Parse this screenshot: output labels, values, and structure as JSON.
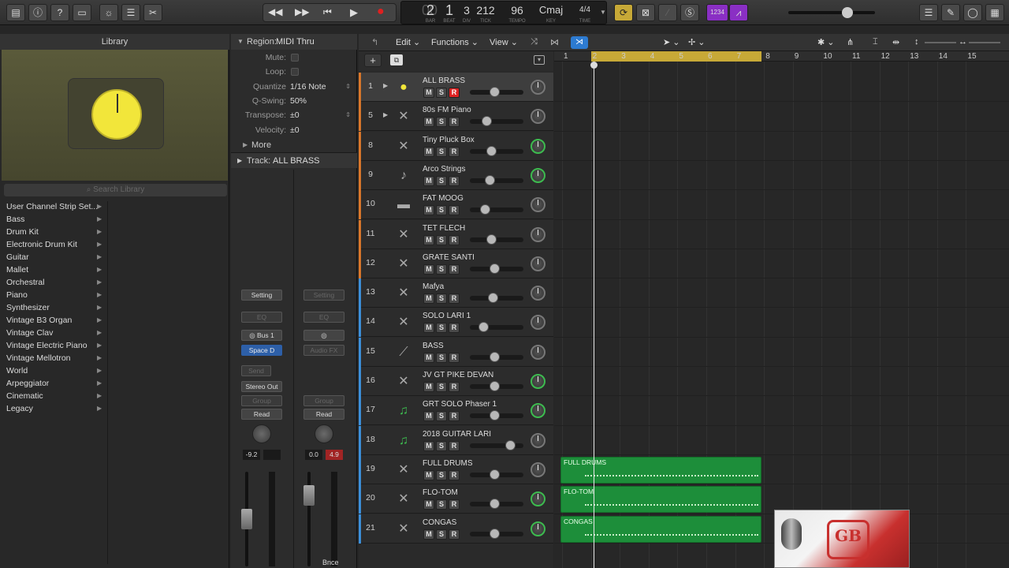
{
  "toolbar": {
    "transport": {
      "rewind": "◀◀",
      "forward": "▶▶",
      "to_start": "⏮",
      "play": "▶",
      "record": "●"
    },
    "lcd": {
      "bar": "2",
      "beat": "1",
      "div": "3",
      "tick": "212",
      "tempo": "96",
      "key": "Cmaj",
      "time": "4/4",
      "bar_label": "BAR",
      "beat_label": "BEAT",
      "div_label": "DIV",
      "tick_label": "TICK",
      "tempo_label": "TEMPO",
      "key_label": "KEY",
      "time_label": "TIME"
    },
    "count_in": "1234"
  },
  "library": {
    "title": "Library",
    "search_placeholder": "Search Library",
    "items": [
      "User Channel Strip Set...",
      "Bass",
      "Drum Kit",
      "Electronic Drum Kit",
      "Guitar",
      "Mallet",
      "Orchestral",
      "Piano",
      "Synthesizer",
      "Vintage B3 Organ",
      "Vintage Clav",
      "Vintage Electric Piano",
      "Vintage Mellotron",
      "World",
      "Arpeggiator",
      "Cinematic",
      "Legacy"
    ]
  },
  "inspector": {
    "region_label": "Region:",
    "region_name": "MIDI Thru",
    "rows": [
      {
        "label": "Mute:",
        "value": ""
      },
      {
        "label": "Loop:",
        "value": ""
      },
      {
        "label": "Quantize",
        "value": "1/16 Note"
      },
      {
        "label": "Q-Swing:",
        "value": "50%"
      },
      {
        "label": "Transpose:",
        "value": "±0"
      },
      {
        "label": "Velocity:",
        "value": "±0"
      }
    ],
    "more": "More",
    "track_label": "Track:",
    "track_name": "ALL BRASS",
    "strip1": {
      "setting": "Setting",
      "eq": "EQ",
      "bus": "Bus 1",
      "insert": "Space D",
      "send": "Send",
      "output": "Stereo Out",
      "group": "Group",
      "auto": "Read",
      "vol": "-9.2"
    },
    "strip2": {
      "setting": "Setting",
      "eq": "EQ",
      "insert": "Audio FX",
      "group": "Group",
      "auto": "Read",
      "vol": "0.0",
      "peak": "4.9",
      "name": "Bnce"
    }
  },
  "tracks_bar": {
    "menus": [
      "Edit",
      "Functions",
      "View"
    ]
  },
  "tracks": [
    {
      "num": "1",
      "name": "ALL BRASS",
      "record": true,
      "icon": "yellow-knob-icon",
      "pan": "gray",
      "sel": true,
      "color": "#d9772b",
      "fader": 0.45
    },
    {
      "num": "5",
      "name": "80s FM Piano",
      "record": false,
      "icon": "keyboard-icon",
      "pan": "gray",
      "color": "#d9772b",
      "fader": 0.27
    },
    {
      "num": "8",
      "name": "Tiny Pluck Box",
      "record": false,
      "icon": "keyboard-icon",
      "pan": "green",
      "color": "#d9772b",
      "fader": 0.39
    },
    {
      "num": "9",
      "name": "Arco Strings",
      "record": false,
      "icon": "violin-icon",
      "pan": "green",
      "color": "#d9772b",
      "fader": 0.35
    },
    {
      "num": "10",
      "name": "FAT MOOG",
      "record": false,
      "icon": "synth-icon",
      "pan": "gray",
      "color": "#d9772b",
      "fader": 0.24
    },
    {
      "num": "11",
      "name": "TET FLECH",
      "record": false,
      "icon": "keyboard-icon",
      "pan": "gray",
      "color": "#d9772b",
      "fader": 0.39
    },
    {
      "num": "12",
      "name": "GRATE SANTI",
      "record": false,
      "icon": "keyboard-icon",
      "pan": "gray",
      "color": "#d9772b",
      "fader": 0.45
    },
    {
      "num": "13",
      "name": "Mafya",
      "record": false,
      "icon": "keyboard-icon",
      "pan": "gray",
      "color": "#3c8fd9",
      "fader": 0.41
    },
    {
      "num": "14",
      "name": "SOLO LARI 1",
      "record": false,
      "icon": "keyboard-icon",
      "pan": "gray",
      "color": "#3c8fd9",
      "fader": 0.2
    },
    {
      "num": "15",
      "name": "BASS",
      "record": false,
      "icon": "guitar-icon",
      "pan": "gray",
      "color": "#3c8fd9",
      "fader": 0.45
    },
    {
      "num": "16",
      "name": "JV GT PIKE DEVAN",
      "record": false,
      "icon": "keyboard-icon",
      "pan": "green",
      "color": "#3c8fd9",
      "fader": 0.45
    },
    {
      "num": "17",
      "name": "GRT SOLO Phaser 1",
      "record": false,
      "icon": "music-note-icon",
      "pan": "green",
      "color": "#3c8fd9",
      "fader": 0.45
    },
    {
      "num": "18",
      "name": "2018 GUITAR LARI",
      "record": false,
      "icon": "music-note-icon",
      "pan": "gray",
      "color": "#3c8fd9",
      "fader": 0.82
    },
    {
      "num": "19",
      "name": "FULL DRUMS",
      "record": false,
      "icon": "keyboard-icon",
      "pan": "gray",
      "color": "#3c8fd9",
      "fader": 0.45
    },
    {
      "num": "20",
      "name": "FLO-TOM",
      "record": false,
      "icon": "keyboard-icon",
      "pan": "green",
      "color": "#3c8fd9",
      "fader": 0.45
    },
    {
      "num": "21",
      "name": "CONGAS",
      "record": false,
      "icon": "keyboard-icon",
      "pan": "green",
      "color": "#3c8fd9",
      "fader": 0.45
    }
  ],
  "ruler": {
    "bars": [
      "1",
      "2",
      "3",
      "4",
      "5",
      "6",
      "7",
      "8",
      "9",
      "10",
      "11",
      "12",
      "13",
      "14",
      "15"
    ]
  },
  "regions": [
    {
      "name": "FULL DRUMS",
      "track_index": 13
    },
    {
      "name": "FLO-TOM",
      "track_index": 14
    },
    {
      "name": "CONGAS",
      "track_index": 15
    }
  ],
  "logo": {
    "mark": "GB"
  }
}
